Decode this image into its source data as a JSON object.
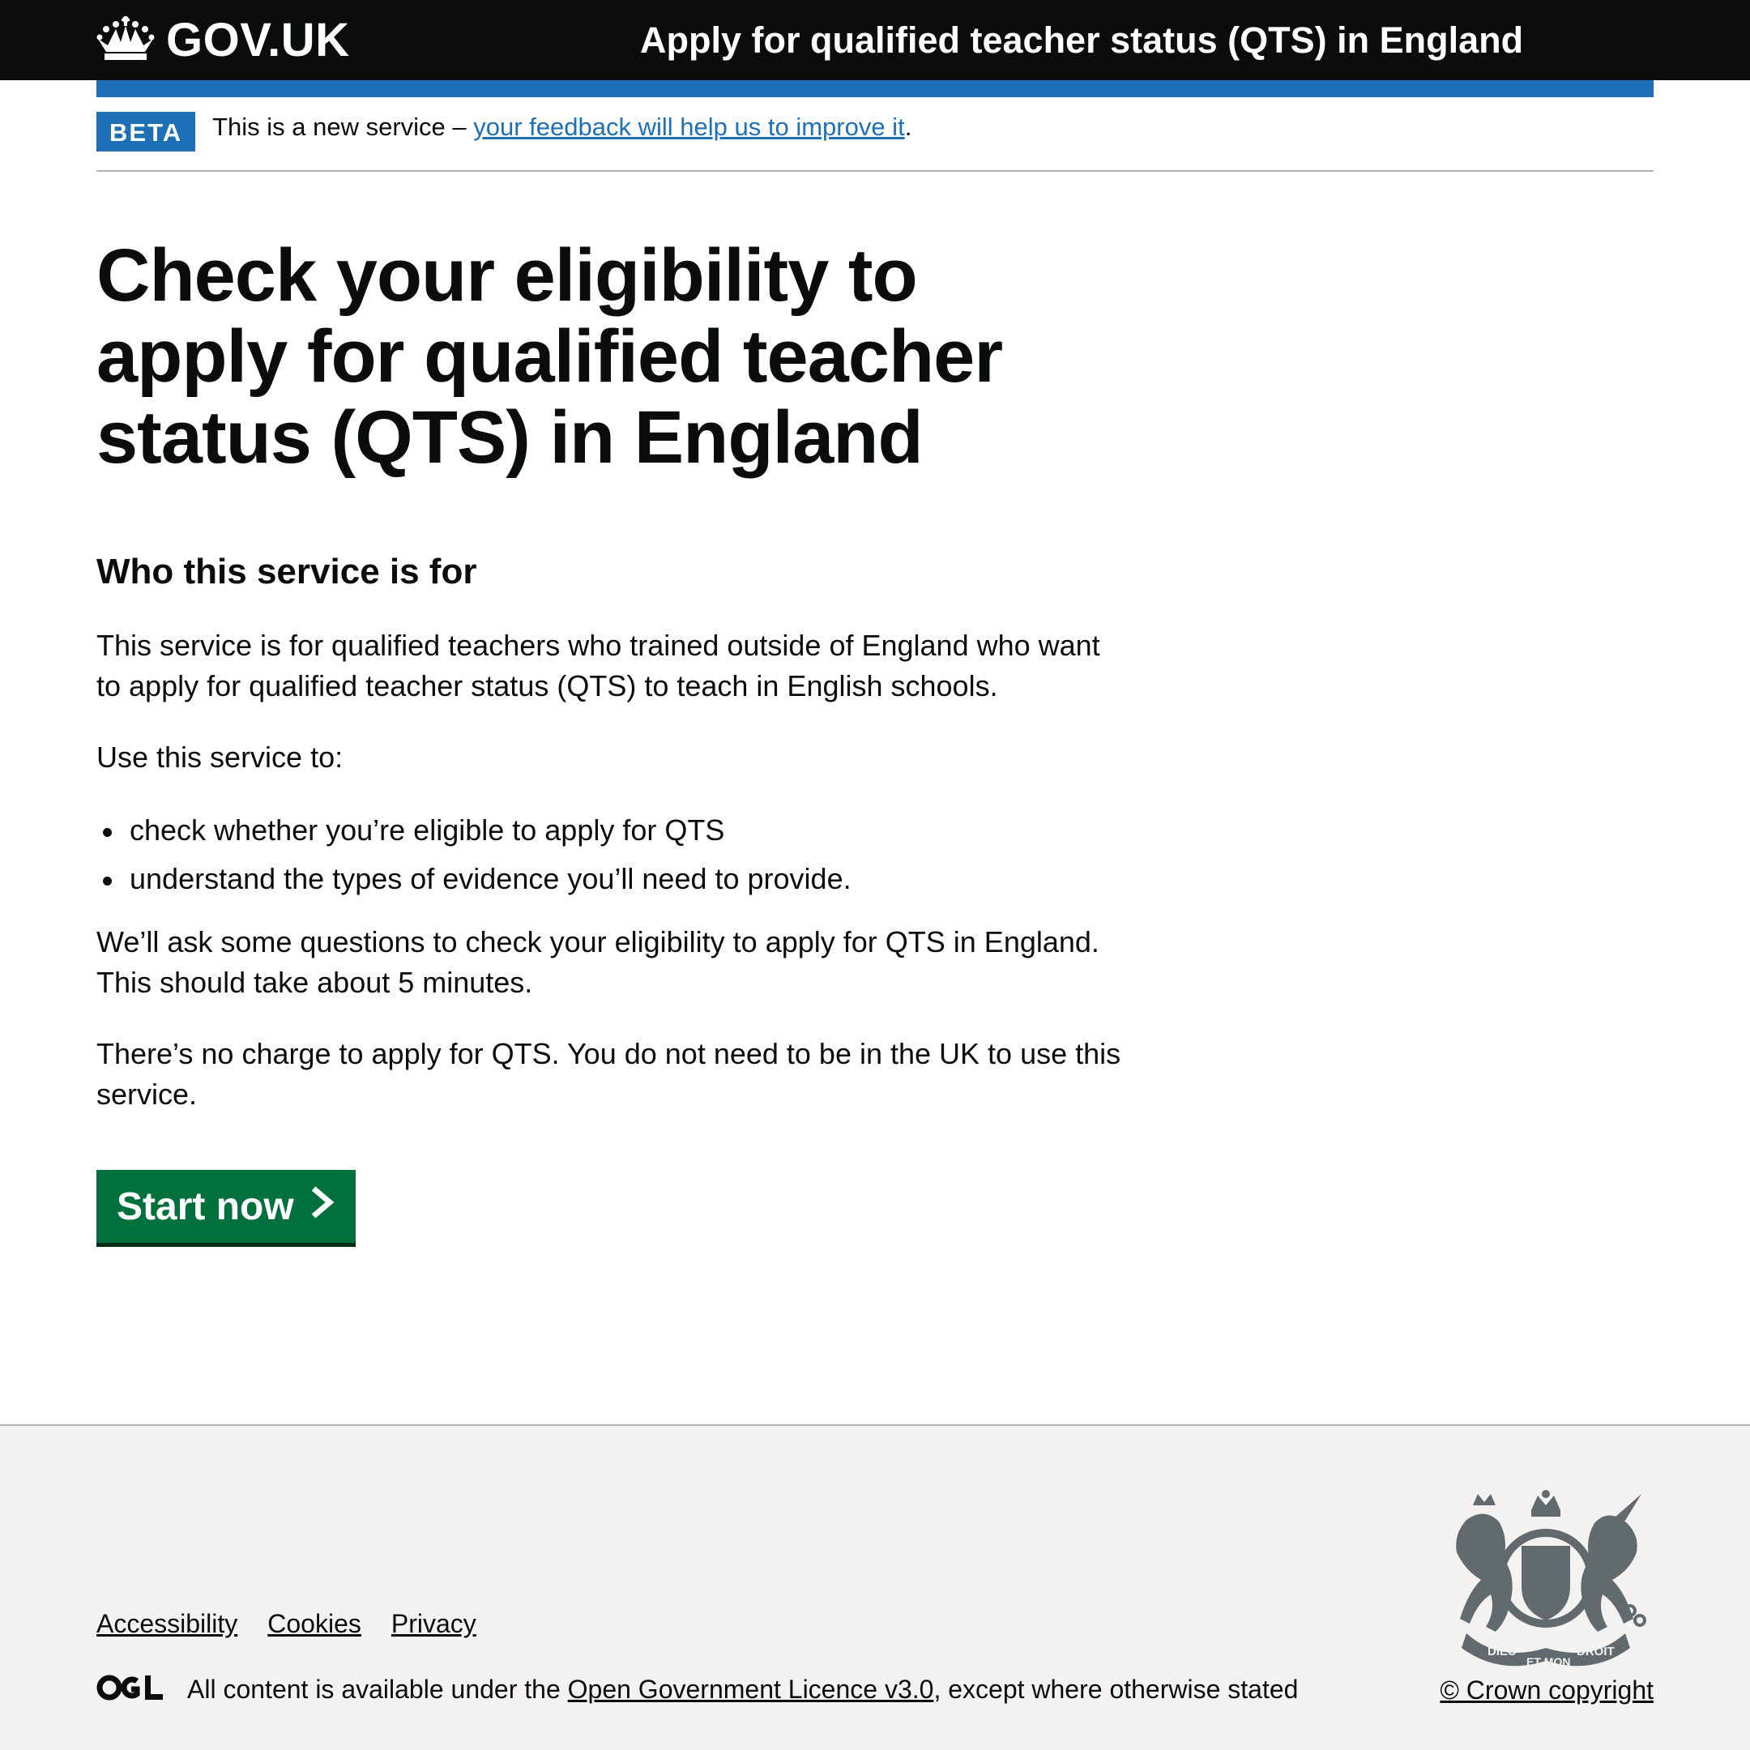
{
  "header": {
    "logo_text": "GOV.UK",
    "logo_icon": "crown-icon",
    "service_name": "Apply for qualified teacher status (QTS) in England"
  },
  "phase_banner": {
    "tag": "BETA",
    "text_prefix": "This is a new service – ",
    "link": "your feedback will help us to improve it",
    "text_suffix": "."
  },
  "main": {
    "title": "Check your eligibility to apply for qualified teacher status (QTS) in England",
    "subheading": "Who this service is for",
    "para1": "This service is for qualified teachers who trained outside of England who want to apply for qualified teacher status (QTS) to teach in English schools.",
    "para2": "Use this service to:",
    "bullets": [
      "check whether you’re eligible to apply for QTS",
      "understand the types of evidence you’ll need to provide."
    ],
    "para3": "We’ll ask some questions to check your eligibility to apply for QTS in England. This should take about 5 minutes.",
    "para4": "There’s no charge to apply for QTS. You do not need to be in the UK to use this service.",
    "start_button": "Start now"
  },
  "footer": {
    "links": [
      "Accessibility",
      "Cookies",
      "Privacy"
    ],
    "licence_prefix": "All content is available under the ",
    "licence_link": "Open Government Licence v3.0",
    "licence_suffix": ", except where otherwise stated",
    "copyright": "© Crown copyright",
    "ogl_logo_text": "OGL",
    "crest_icon": "royal-coat-of-arms-icon",
    "crest_motto_1": "DIEU",
    "crest_motto_2": "ET MON",
    "crest_motto_3": "DROIT"
  },
  "colors": {
    "header_bg": "#0b0c0c",
    "brand_blue": "#1d70b8",
    "start_green": "#00703c",
    "footer_bg": "#f3f2f1"
  }
}
